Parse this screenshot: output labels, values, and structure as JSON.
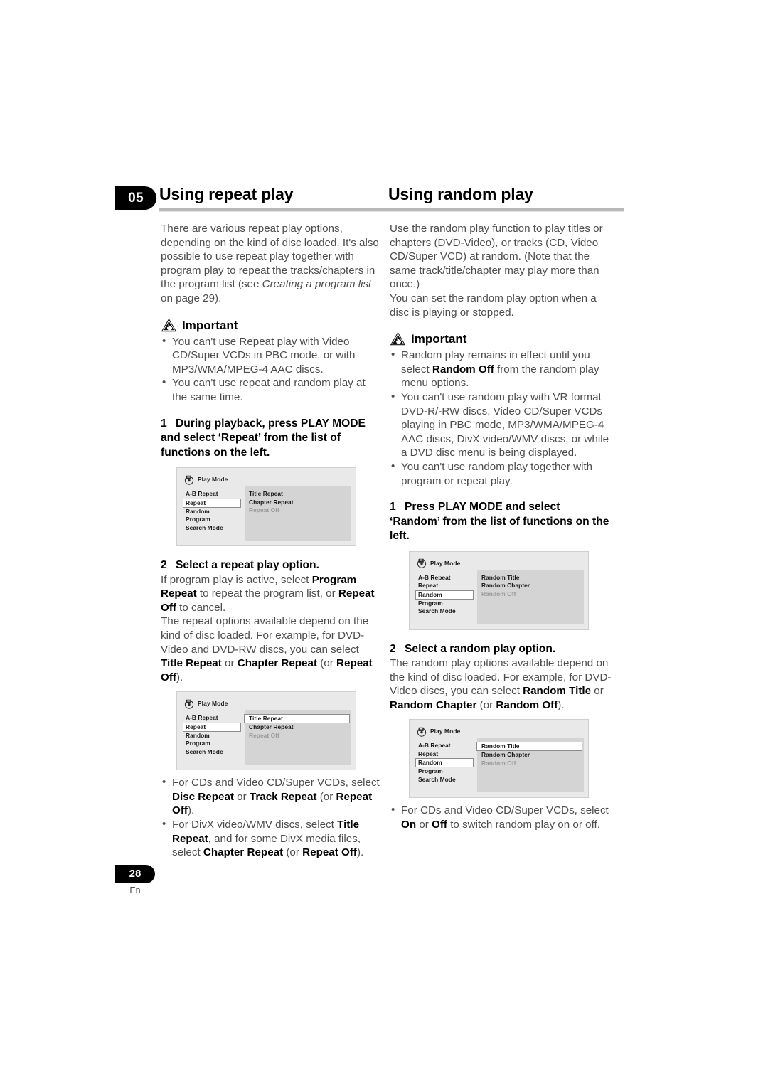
{
  "document": {
    "chapter_number": "05",
    "page_number": "28",
    "page_language": "En"
  },
  "left_column": {
    "heading": "Using repeat play",
    "intro": "There are various repeat play options, depending on the kind of disc loaded. It's also possible to use repeat play together with program play to repeat the tracks/chapters in the program list (see ",
    "intro_italic": "Creating a program list",
    "intro_tail": " on page 29).",
    "important": {
      "label": "Important",
      "icon": "warning-triangle-hand-icon",
      "bullets": [
        "You can't use Repeat play with Video CD/Super VCDs in PBC mode, or with MP3/WMA/MPEG-4 AAC discs.",
        "You can't use repeat and random play at the same time."
      ]
    },
    "step1": {
      "number": "1",
      "title": "During playback, press PLAY MODE and select ‘Repeat’ from the list of functions on the left."
    },
    "step2": {
      "number": "2",
      "title": "Select a repeat play option.",
      "para1_a": "If program play is active, select ",
      "para1_b1": "Program Repeat",
      "para1_c": " to repeat the program list, or ",
      "para1_b2": "Repeat Off",
      "para1_d": " to cancel.",
      "para2_a": "The repeat options available depend on the kind of disc loaded. For example, for DVD-Video and DVD-RW discs, you can select ",
      "para2_b1": "Title Repeat",
      "para2_c": " or ",
      "para2_b2": "Chapter Repeat",
      "para2_d": " (or ",
      "para2_b3": "Repeat Off",
      "para2_e": ")."
    },
    "closing_bullets": [
      {
        "a": "For CDs and Video CD/Super VCDs, select ",
        "b1": "Disc Repeat",
        "c": " or ",
        "b2": "Track Repeat",
        "d": " (or ",
        "b3": "Repeat Off",
        "e": ")."
      },
      {
        "a": "For DivX video/WMV discs, select ",
        "b1": "Title Repeat",
        "c": ", and for some DivX media files, select ",
        "b2": "Chapter Repeat",
        "d": " (or ",
        "b3": "Repeat Off",
        "e": ")."
      }
    ],
    "osd1": {
      "title": "Play Mode",
      "icon": "disc-play-mode-icon",
      "menu": [
        "A-B Repeat",
        "Repeat",
        "Random",
        "Program",
        "Search Mode"
      ],
      "menu_selected": "Repeat",
      "options": [
        "Title Repeat",
        "Chapter Repeat",
        "Repeat Off"
      ],
      "options_dim": "Repeat Off",
      "option_selected": ""
    },
    "osd2": {
      "title": "Play Mode",
      "icon": "disc-play-mode-icon",
      "menu": [
        "A-B Repeat",
        "Repeat",
        "Random",
        "Program",
        "Search Mode"
      ],
      "menu_selected": "Repeat",
      "options": [
        "Title Repeat",
        "Chapter Repeat",
        "Repeat Off"
      ],
      "options_dim": "Repeat Off",
      "option_selected": "Title Repeat"
    }
  },
  "right_column": {
    "heading": "Using random play",
    "intro1": "Use the random play function to play titles or chapters (DVD-Video), or tracks (CD, Video CD/Super VCD) at random. (Note that the same track/title/chapter may play more than once.)",
    "intro2": "You can set the random play option when a disc is playing or stopped.",
    "important": {
      "label": "Important",
      "icon": "warning-triangle-hand-icon",
      "bullets": [
        {
          "a": "Random play remains in effect until you select ",
          "b": "Random Off",
          "c": " from the random play menu options."
        },
        {
          "a": "You can't use random play with VR format DVD-R/-RW discs, Video CD/Super VCDs playing in PBC mode, MP3/WMA/MPEG-4 AAC discs, DivX video/WMV discs, or while a DVD disc menu is being displayed.",
          "b": "",
          "c": ""
        },
        {
          "a": "You can't use random play together with program or repeat play.",
          "b": "",
          "c": ""
        }
      ]
    },
    "step1": {
      "number": "1",
      "title": "Press PLAY MODE and select ‘Random’ from the list of functions on the left."
    },
    "step2": {
      "number": "2",
      "title": "Select a random play option.",
      "para_a": "The random play options available depend on the kind of disc loaded. For example, for DVD-Video discs, you can select ",
      "para_b1": "Random Title",
      "para_c": " or ",
      "para_b2": "Random Chapter",
      "para_d": " (or ",
      "para_b3": "Random Off",
      "para_e": ")."
    },
    "closing_bullets": [
      {
        "a": "For CDs and Video CD/Super VCDs, select ",
        "b1": "On",
        "c": " or ",
        "b2": "Off",
        "d": " to switch random play on or off.",
        "b3": "",
        "e": ""
      }
    ],
    "osd1": {
      "title": "Play Mode",
      "icon": "disc-play-mode-icon",
      "menu": [
        "A-B Repeat",
        "Repeat",
        "Random",
        "Program",
        "Search Mode"
      ],
      "menu_selected": "Random",
      "options": [
        "Random Title",
        "Random Chapter",
        "Random Off"
      ],
      "options_dim": "Random Off",
      "option_selected": ""
    },
    "osd2": {
      "title": "Play Mode",
      "icon": "disc-play-mode-icon",
      "menu": [
        "A-B Repeat",
        "Repeat",
        "Random",
        "Program",
        "Search Mode"
      ],
      "menu_selected": "Random",
      "options": [
        "Random Title",
        "Random Chapter",
        "Random Off"
      ],
      "options_dim": "Random Off",
      "option_selected": "Random Title"
    }
  },
  "colors": {
    "body_text": "#4d4d4d",
    "bold_text": "#000000",
    "rule": "#b9b9b9",
    "osd_background": "#e9e9e9",
    "osd_pane": "#d4d4d4",
    "tab_background": "#000000"
  }
}
